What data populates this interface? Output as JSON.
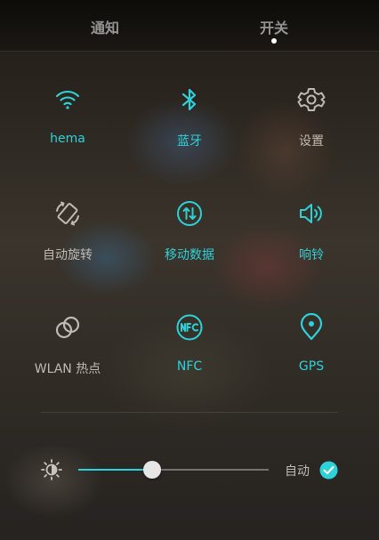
{
  "tabs": [
    {
      "label": "通知",
      "active": false
    },
    {
      "label": "开关",
      "active": true
    }
  ],
  "toggles": [
    {
      "label": "hema",
      "icon": "wifi-icon",
      "on": true
    },
    {
      "label": "蓝牙",
      "icon": "bluetooth-icon",
      "on": true
    },
    {
      "label": "设置",
      "icon": "gear-icon",
      "on": false
    },
    {
      "label": "自动旋转",
      "icon": "auto-rotate-icon",
      "on": false
    },
    {
      "label": "移动数据",
      "icon": "mobile-data-icon",
      "on": true
    },
    {
      "label": "响铃",
      "icon": "speaker-icon",
      "on": true
    },
    {
      "label": "WLAN 热点",
      "icon": "hotspot-icon",
      "on": false
    },
    {
      "label": "NFC",
      "icon": "nfc-icon",
      "on": true
    },
    {
      "label": "GPS",
      "icon": "location-pin-icon",
      "on": true
    }
  ],
  "brightness": {
    "icon": "brightness-icon",
    "level": 0.39,
    "auto_label": "自动",
    "auto_checked": true
  },
  "colors": {
    "accent": "#2fd1d8",
    "inactive": "#bfbab3",
    "text": "#f1f1f1"
  }
}
